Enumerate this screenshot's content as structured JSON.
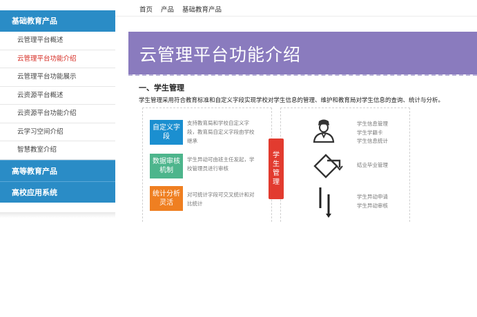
{
  "breadcrumb": [
    "首页",
    "产品",
    "基础教育产品"
  ],
  "sidebar": {
    "header": "基础教育产品",
    "items": [
      {
        "label": "云管理平台概述",
        "active": false
      },
      {
        "label": "云管理平台功能介绍",
        "active": true
      },
      {
        "label": "云管理平台功能展示",
        "active": false
      },
      {
        "label": "云资源平台概述",
        "active": false
      },
      {
        "label": "云资源平台功能介绍",
        "active": false
      },
      {
        "label": "云学习空间介绍",
        "active": false
      },
      {
        "label": "智慧教室介绍",
        "active": false
      }
    ],
    "groups": [
      "高等教育产品",
      "高校应用系统"
    ]
  },
  "banner": {
    "title": "云管理平台功能介绍",
    "color": "#8a7bbe"
  },
  "section": {
    "title": "一、学生管理",
    "description": "学生管理采用符合教育标准和自定义字段实现学校对学生信息的管理、维护和教育局对学生信息的查询、统计与分析。"
  },
  "features": [
    {
      "label": "自定义字段",
      "desc": "支持教育局和学校自定义字段，教育局自定义字段由学校继承",
      "color": "#1b8fd0"
    },
    {
      "label": "数据审核机制",
      "desc": "学生异动可由班主任发起，学校管理员进行审核",
      "color": "#4db58c"
    },
    {
      "label": "统计分析灵活",
      "desc": "对可统计字段可交叉统计和对比统计",
      "color": "#ef7f21"
    }
  ],
  "tag": {
    "label": "学生管理",
    "color": "#e23b2f"
  },
  "right_groups": [
    {
      "icon": "student-icon",
      "items": [
        "学生信息管理",
        "学生学籍卡",
        "学生信息统计"
      ]
    },
    {
      "icon": "diamond-arrow-icon",
      "items": [
        "结业毕业管理"
      ]
    },
    {
      "icon": "transfer-arrows-icon",
      "items": [
        "学生异动申请",
        "学生异动审核"
      ]
    }
  ]
}
